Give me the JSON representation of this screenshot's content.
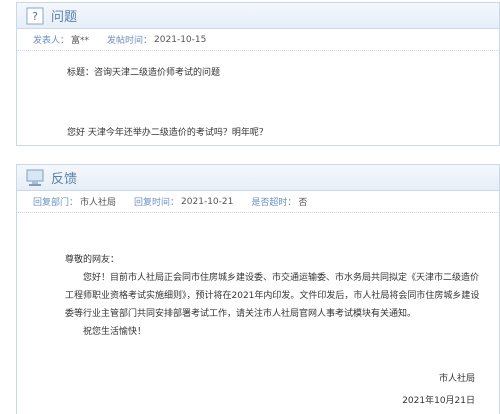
{
  "question": {
    "header_title": "问题",
    "meta": {
      "author_label": "发表人：",
      "author_value": "富**",
      "time_label": "发帖时间：",
      "time_value": "2021-10-15"
    },
    "title": "标题：咨询天津二级造价师考试的问题",
    "body": "您好 天津今年还举办二级造价的考试吗？明年呢？"
  },
  "feedback": {
    "header_title": "反馈",
    "meta": {
      "dept_label": "回复部门：",
      "dept_value": "市人社局",
      "time_label": "回复时间：",
      "time_value": "2021-10-21",
      "overdue_label": "是否超时：",
      "overdue_value": "否"
    },
    "greeting": "尊敬的网友：",
    "paragraph": "您好！目前市人社局正会同市住房城乡建设委、市交通运输委、市水务局共同拟定《天津市二级造价工程师职业资格考试实施细则》，预计将在2021年内印发。文件印发后，市人社局将会同市住房城乡建设委等行业主管部门共同安排部署考试工作，请关注市人社局官网人事考试模块有关通知。",
    "closing": "祝您生活愉快！",
    "signature": "市人社局",
    "date": "2021年10月21日"
  },
  "colors": {
    "accent": "#6a8fc4",
    "border": "#c9d9ea",
    "title": "#5a7fa8"
  }
}
